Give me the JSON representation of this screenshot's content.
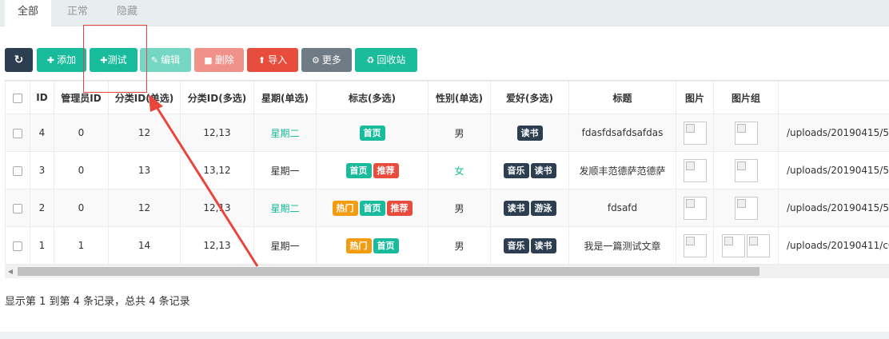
{
  "tabs": [
    {
      "label": "全部",
      "active": true
    },
    {
      "label": "正常",
      "active": false
    },
    {
      "label": "隐藏",
      "active": false
    }
  ],
  "toolbar": {
    "refresh_icon": "refresh-icon",
    "add_label": "添加",
    "test_label": "测试",
    "edit_label": "编辑",
    "delete_label": "删除",
    "import_label": "导入",
    "more_label": "更多",
    "recycle_label": "回收站"
  },
  "table": {
    "headers": [
      "ID",
      "管理员ID",
      "分类ID(单选)",
      "分类ID(多选)",
      "星期(单选)",
      "标志(多选)",
      "性别(单选)",
      "爱好(多选)",
      "标题",
      "图片",
      "图片组",
      ""
    ],
    "rows": [
      {
        "id": "4",
        "admin_id": "0",
        "cat_single": "12",
        "cat_multi": "12,13",
        "week": "星期二",
        "week_green": true,
        "flags": [
          {
            "text": "首页",
            "color": "green"
          }
        ],
        "gender": "男",
        "gender_green": false,
        "hobbies": [
          "读书"
        ],
        "title": "fdasfdsafdsafdas",
        "images": 1,
        "image_group": 1,
        "path": "/uploads/20190415/55"
      },
      {
        "id": "3",
        "admin_id": "0",
        "cat_single": "13",
        "cat_multi": "13,12",
        "week": "星期一",
        "week_green": false,
        "flags": [
          {
            "text": "首页",
            "color": "green"
          },
          {
            "text": "推荐",
            "color": "red"
          }
        ],
        "gender": "女",
        "gender_green": true,
        "hobbies": [
          "音乐",
          "读书"
        ],
        "title": "发顺丰范德萨范德萨",
        "images": 1,
        "image_group": 1,
        "path": "/uploads/20190415/55"
      },
      {
        "id": "2",
        "admin_id": "0",
        "cat_single": "12",
        "cat_multi": "12,13",
        "week": "星期二",
        "week_green": true,
        "flags": [
          {
            "text": "热门",
            "color": "orange"
          },
          {
            "text": "首页",
            "color": "green"
          },
          {
            "text": "推荐",
            "color": "red"
          }
        ],
        "gender": "男",
        "gender_green": false,
        "hobbies": [
          "读书",
          "游泳"
        ],
        "title": "fdsafd",
        "images": 1,
        "image_group": 1,
        "path": "/uploads/20190415/55"
      },
      {
        "id": "1",
        "admin_id": "1",
        "cat_single": "14",
        "cat_multi": "12,13",
        "week": "星期一",
        "week_green": false,
        "flags": [
          {
            "text": "热门",
            "color": "orange"
          },
          {
            "text": "首页",
            "color": "green"
          }
        ],
        "gender": "男",
        "gender_green": false,
        "hobbies": [
          "音乐",
          "读书"
        ],
        "title": "我是一篇测试文章",
        "images": 1,
        "image_group": 2,
        "path": "/uploads/20190411/c0f"
      }
    ]
  },
  "footer": {
    "info": "显示第 1 到第 4 条记录，总共 4 条记录"
  },
  "colors": {
    "green": "#18bc9c",
    "red": "#e74c3c",
    "orange": "#f39c12",
    "dark": "#2c3e50",
    "annotation": "#e8453c"
  }
}
